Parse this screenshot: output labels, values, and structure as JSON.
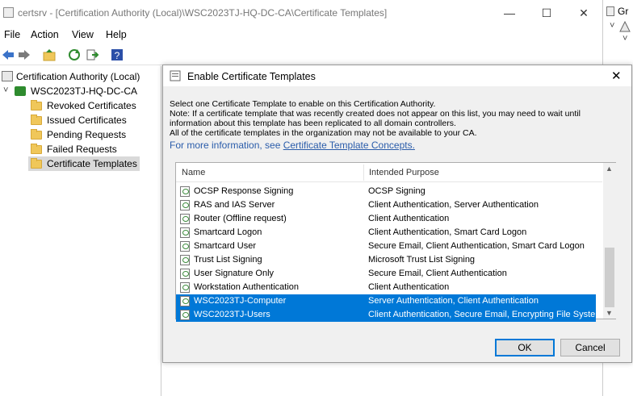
{
  "main_window": {
    "title": "certsrv - [Certification Authority (Local)\\WSC2023TJ-HQ-DC-CA\\Certificate Templates]",
    "minimize": "—",
    "maximize": "☐",
    "close": "✕"
  },
  "menu": [
    "File",
    "Action",
    "View",
    "Help"
  ],
  "tree": {
    "root": "Certification Authority (Local)",
    "ca": "WSC2023TJ-HQ-DC-CA",
    "folders": [
      "Revoked Certificates",
      "Issued Certificates",
      "Pending Requests",
      "Failed Requests",
      "Certificate Templates"
    ]
  },
  "side_pane": {
    "label": "Gr"
  },
  "dialog": {
    "title": "Enable Certificate Templates",
    "close": "✕",
    "desc1": "Select one Certificate Template to enable on this Certification Authority.",
    "desc2": "Note: If a certificate template that was recently created does not appear on this list, you may need to wait until",
    "desc3": "information about this template has been replicated to all domain controllers.",
    "desc4": "All of the certificate templates in the organization may not be available to your CA.",
    "more_info_prefix": "For more information, see ",
    "more_info_link": "Certificate Template Concepts.",
    "columns": [
      "Name",
      "Intended Purpose"
    ],
    "rows": [
      {
        "name": "OCSP Response Signing",
        "purpose": "OCSP Signing"
      },
      {
        "name": "RAS and IAS Server",
        "purpose": "Client Authentication, Server Authentication"
      },
      {
        "name": "Router (Offline request)",
        "purpose": "Client Authentication"
      },
      {
        "name": "Smartcard Logon",
        "purpose": "Client Authentication, Smart Card Logon"
      },
      {
        "name": "Smartcard User",
        "purpose": "Secure Email, Client Authentication, Smart Card Logon"
      },
      {
        "name": "Trust List Signing",
        "purpose": "Microsoft Trust List Signing"
      },
      {
        "name": "User Signature Only",
        "purpose": "Secure Email, Client Authentication"
      },
      {
        "name": "Workstation Authentication",
        "purpose": "Client Authentication"
      },
      {
        "name": "WSC2023TJ-Computer",
        "purpose": "Server Authentication, Client Authentication"
      },
      {
        "name": "WSC2023TJ-Users",
        "purpose": "Client Authentication, Secure Email, Encrypting File System"
      }
    ],
    "ok": "OK",
    "cancel": "Cancel"
  }
}
